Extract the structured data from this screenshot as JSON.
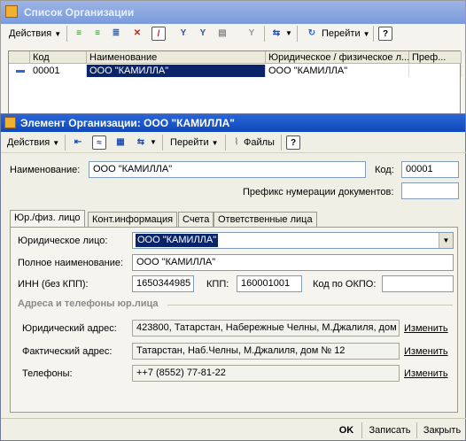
{
  "list_window": {
    "title": "Список Организации",
    "toolbar": {
      "actions_label": "Действия",
      "goto_label": "Перейти",
      "help_label": "?"
    },
    "columns": [
      "Код",
      "Наименование",
      "Юридическое / физическое л...",
      "Преф..."
    ],
    "rows": [
      {
        "code": "00001",
        "name": "ООО \"КАМИЛЛА\"",
        "legal": "ООО \"КАМИЛЛА\"",
        "prefix": ""
      }
    ]
  },
  "element_window": {
    "title": "Элемент Организации: ООО \"КАМИЛЛА\"",
    "toolbar": {
      "actions_label": "Действия",
      "goto_label": "Перейти",
      "files_label": "Файлы",
      "help_label": "?"
    },
    "name_label": "Наименование:",
    "name_value": "ООО \"КАМИЛЛА\"",
    "code_label": "Код:",
    "code_value": "00001",
    "prefix_label": "Префикс нумерации документов:",
    "prefix_value": "",
    "tabs": [
      "Юр./физ. лицо",
      "Конт.информация",
      "Счета",
      "Ответственные лица"
    ],
    "legal_entity_label": "Юридическое лицо:",
    "legal_entity_value": "ООО \"КАМИЛЛА\"",
    "full_name_label": "Полное наименование:",
    "full_name_value": "ООО \"КАМИЛЛА\"",
    "inn_label": "ИНН (без КПП):",
    "inn_value": "1650344985",
    "kpp_label": "КПП:",
    "kpp_value": "160001001",
    "okpo_label": "Код по ОКПО:",
    "okpo_value": "",
    "section_title": "Адреса и телефоны юр.лица",
    "legal_address_label": "Юридический адрес:",
    "legal_address_value": "423800, Татарстан, Набережные Челны, М.Джалиля, дом",
    "actual_address_label": "Фактический адрес:",
    "actual_address_value": "Татарстан, Наб.Челны, М.Джалиля, дом № 12",
    "phones_label": "Телефоны:",
    "phones_value": "++7 (8552) 77-81-22",
    "change_label": "Изменить",
    "footer": {
      "ok": "OK",
      "save": "Записать",
      "close": "Закрыть"
    }
  }
}
